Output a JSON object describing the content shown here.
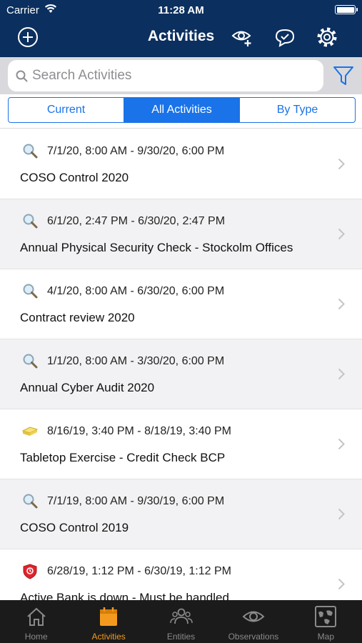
{
  "status_bar": {
    "carrier": "Carrier",
    "time": "11:28 AM"
  },
  "nav": {
    "title": "Activities"
  },
  "search": {
    "placeholder": "Search Activities",
    "value": ""
  },
  "segments": [
    {
      "label": "Current",
      "active": false
    },
    {
      "label": "All Activities",
      "active": true
    },
    {
      "label": "By Type",
      "active": false
    }
  ],
  "activities": [
    {
      "icon": "magnifier-icon",
      "dates": "7/1/20, 8:00 AM - 9/30/20, 6:00 PM",
      "title": "COSO Control 2020"
    },
    {
      "icon": "magnifier-icon",
      "dates": "6/1/20, 2:47 PM - 6/30/20, 2:47 PM",
      "title": "Annual Physical Security Check - Stockolm Offices"
    },
    {
      "icon": "magnifier-icon",
      "dates": "4/1/20, 8:00 AM - 6/30/20, 6:00 PM",
      "title": "Contract review 2020"
    },
    {
      "icon": "magnifier-icon",
      "dates": "1/1/20, 8:00 AM - 3/30/20, 6:00 PM",
      "title": "Annual Cyber Audit 2020"
    },
    {
      "icon": "tabletop-icon",
      "dates": "8/16/19, 3:40 PM - 8/18/19, 3:40 PM",
      "title": "Tabletop Exercise - Credit Check BCP"
    },
    {
      "icon": "magnifier-icon",
      "dates": "7/1/19, 8:00 AM - 9/30/19, 6:00 PM",
      "title": "COSO Control 2019"
    },
    {
      "icon": "shield-icon",
      "dates": "6/28/19, 1:12 PM - 6/30/19, 1:12 PM",
      "title": "Active Bank is down - Must be handled"
    }
  ],
  "tabs": [
    {
      "label": "Home",
      "icon": "home-icon",
      "active": false
    },
    {
      "label": "Activities",
      "icon": "calendar-icon",
      "active": true
    },
    {
      "label": "Entities",
      "icon": "people-icon",
      "active": false
    },
    {
      "label": "Observations",
      "icon": "eye-icon",
      "active": false
    },
    {
      "label": "Map",
      "icon": "map-icon",
      "active": false
    }
  ],
  "colors": {
    "nav": "#0b2f5e",
    "accent": "#1a73e8",
    "tab_active": "#f39a1e",
    "tabbar": "#1b1b1b"
  }
}
